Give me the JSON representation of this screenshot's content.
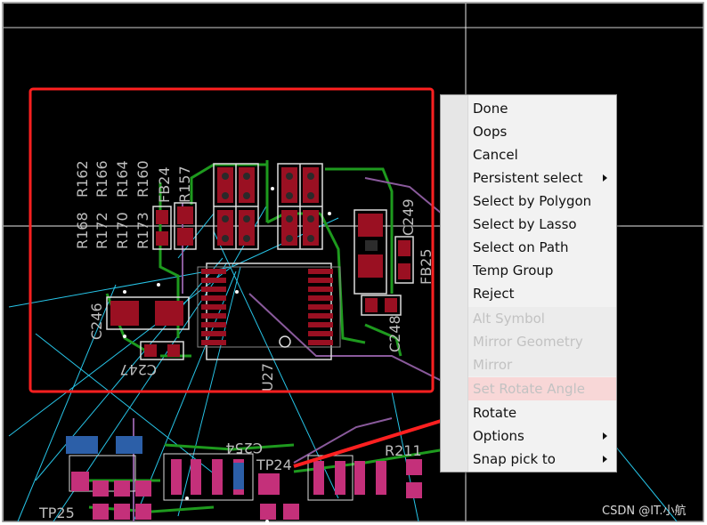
{
  "canvas": {
    "background": "#000000",
    "selection_box_color": "#ff2020",
    "accent_cyan": "#27c5e8",
    "outline_white": "#dddddd",
    "trace_green": "#1e9a1e",
    "trace_purple": "#8a5a9c",
    "pad_red": "#9a1022",
    "pad_magenta": "#c4307a",
    "pad_blue": "#2c5fa8"
  },
  "labels": {
    "r168": "R168",
    "r172": "R172",
    "r170": "R170",
    "r162": "R162",
    "r166": "R166",
    "r164": "R164",
    "r173": "R173",
    "r160": "R160",
    "fb24": "FB24",
    "r157": "R157",
    "c249": "C249",
    "fb25": "FB25",
    "c246": "C246",
    "c247": "C247",
    "c248": "C248",
    "u27": "U27",
    "tp24": "TP24",
    "tp25": "TP25",
    "c254": "C254",
    "r211": "R211"
  },
  "context_menu": {
    "items": [
      {
        "label": "Done",
        "state": "enabled",
        "submenu": false
      },
      {
        "label": "Oops",
        "state": "enabled",
        "submenu": false
      },
      {
        "label": "Cancel",
        "state": "enabled",
        "submenu": false
      },
      {
        "label": "Persistent select",
        "state": "enabled",
        "submenu": true
      },
      {
        "label": "Select by Polygon",
        "state": "enabled",
        "submenu": false
      },
      {
        "label": "Select by Lasso",
        "state": "enabled",
        "submenu": false
      },
      {
        "label": "Select on Path",
        "state": "enabled",
        "submenu": false
      },
      {
        "label": "Temp Group",
        "state": "enabled",
        "submenu": false
      },
      {
        "label": "Reject",
        "state": "enabled",
        "submenu": false
      },
      {
        "label": "Alt Symbol",
        "state": "disabled",
        "submenu": false
      },
      {
        "label": "Mirror Geometry",
        "state": "disabled",
        "submenu": false
      },
      {
        "label": "Mirror",
        "state": "disabled",
        "submenu": false
      },
      {
        "label": "Set Rotate Angle",
        "state": "disabled-highlighted",
        "submenu": false
      },
      {
        "label": "Rotate",
        "state": "enabled",
        "submenu": false
      },
      {
        "label": "Options",
        "state": "enabled",
        "submenu": true
      },
      {
        "label": "Snap pick to",
        "state": "enabled",
        "submenu": true
      }
    ]
  },
  "watermark": "CSDN @IT.小航"
}
